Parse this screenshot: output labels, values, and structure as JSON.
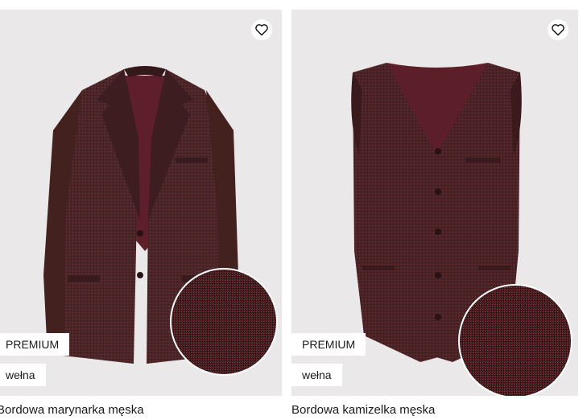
{
  "products": [
    {
      "name": "Bordowa marynarka męska",
      "badges": {
        "premium": "PREMIUM",
        "material": "wełna"
      },
      "image_icon": "blazer-image",
      "favorite_icon": "heart-icon"
    },
    {
      "name": "Bordowa kamizelka męska",
      "badges": {
        "premium": "PREMIUM",
        "material": "wełna"
      },
      "image_icon": "vest-image",
      "favorite_icon": "heart-icon"
    }
  ],
  "colors": {
    "card_background": "#eae8e9",
    "fabric": "#4a2629",
    "fabric_dark": "#3a1c1f",
    "lining": "#6a2530"
  }
}
